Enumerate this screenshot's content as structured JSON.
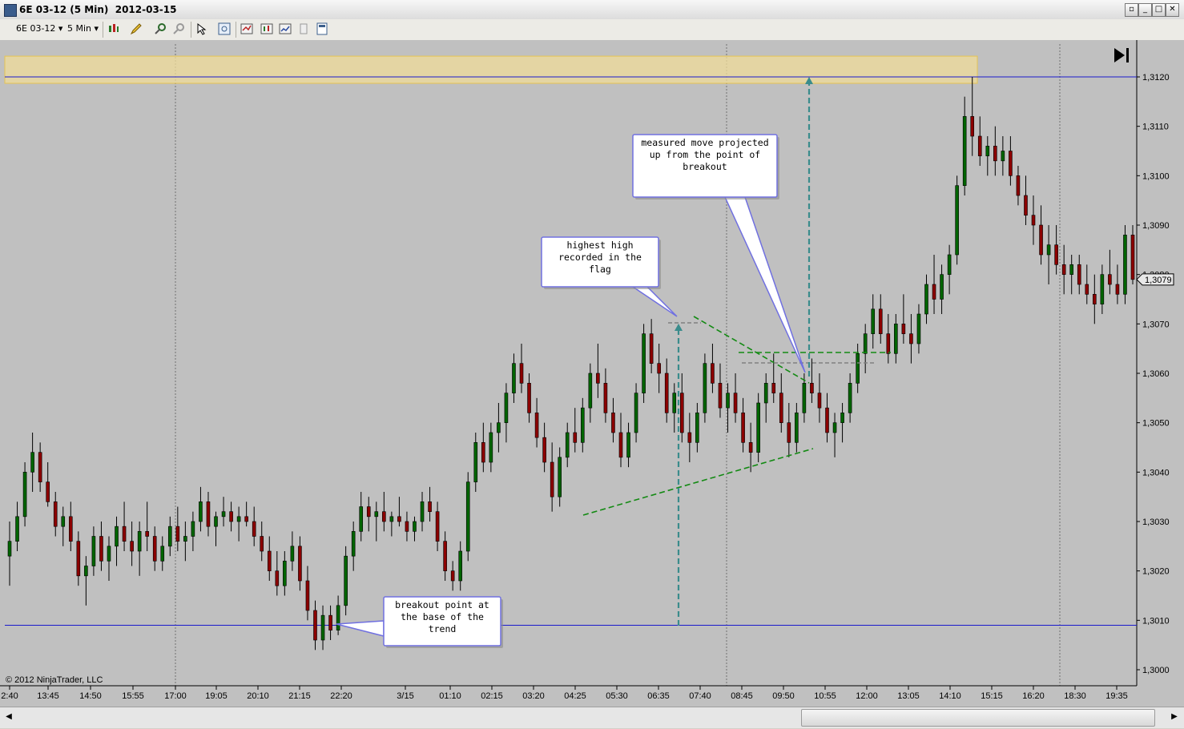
{
  "window": {
    "title": "6E 03-12 (5 Min)  2012-03-15",
    "buttons": [
      "restore-left",
      "minimize",
      "maximize",
      "close"
    ]
  },
  "toolbar": {
    "instrument": "6E 03-12",
    "interval": "5 Min",
    "icons": [
      "bar-type-icon",
      "draw-pencil-icon",
      "zoom-in-icon",
      "zoom-out-icon",
      "pointer-icon",
      "magnifier-icon",
      "indicators-icon",
      "strategies-icon",
      "chart-properties-icon",
      "data-box-icon",
      "panel-icon"
    ]
  },
  "chart_data": {
    "type": "candlestick",
    "instrument": "6E 03-12",
    "period": "5 Min",
    "copyright": "© 2012 NinjaTrader, LLC",
    "y_ticks": [
      "1,3120",
      "1,3110",
      "1,3100",
      "1,3090",
      "1,3080",
      "1,3070",
      "1,3060",
      "1,3050",
      "1,3040",
      "1,3030",
      "1,3020",
      "1,3010",
      "1,3000"
    ],
    "ylim": [
      1.2998,
      1.3126
    ],
    "current_price_label": "1,3079",
    "current_price": 1.3079,
    "x_ticks": [
      "2:40",
      "13:45",
      "14:50",
      "15:55",
      "17:00",
      "19:05",
      "20:10",
      "21:15",
      "22:20",
      "3/15",
      "01:10",
      "02:15",
      "03:20",
      "04:25",
      "05:30",
      "06:35",
      "07:40",
      "08:45",
      "09:50",
      "10:55",
      "12:00",
      "13:05",
      "14:10",
      "15:15",
      "16:20",
      "18:30",
      "19:35"
    ],
    "horizontal_lines": [
      {
        "name": "resistance-line",
        "price": 1.312,
        "color": "#1a1acc"
      },
      {
        "name": "breakout-base-line",
        "price": 1.3009,
        "color": "#1a1acc"
      }
    ],
    "resistance_zone": {
      "from": 1.31187,
      "to": 1.31242,
      "color": "#f0dc9a"
    },
    "candles": [
      [
        1.3023,
        1.303,
        1.3017,
        1.3026
      ],
      [
        1.3026,
        1.3034,
        1.3024,
        1.3031
      ],
      [
        1.3031,
        1.3042,
        1.3029,
        1.304
      ],
      [
        1.304,
        1.3048,
        1.3036,
        1.3044
      ],
      [
        1.3044,
        1.3046,
        1.3036,
        1.3038
      ],
      [
        1.3038,
        1.3042,
        1.3033,
        1.3034
      ],
      [
        1.3034,
        1.3036,
        1.3027,
        1.3029
      ],
      [
        1.3029,
        1.3033,
        1.3025,
        1.3031
      ],
      [
        1.3031,
        1.3034,
        1.3024,
        1.3026
      ],
      [
        1.3026,
        1.3028,
        1.3017,
        1.3019
      ],
      [
        1.3019,
        1.3023,
        1.3013,
        1.3021
      ],
      [
        1.3021,
        1.3029,
        1.3019,
        1.3027
      ],
      [
        1.3027,
        1.303,
        1.302,
        1.3022
      ],
      [
        1.3022,
        1.3027,
        1.3018,
        1.3025
      ],
      [
        1.3025,
        1.3031,
        1.3021,
        1.3029
      ],
      [
        1.3029,
        1.3034,
        1.3024,
        1.3026
      ],
      [
        1.3026,
        1.303,
        1.3021,
        1.3024
      ],
      [
        1.3024,
        1.303,
        1.3019,
        1.3028
      ],
      [
        1.3028,
        1.3034,
        1.3024,
        1.3027
      ],
      [
        1.3027,
        1.3029,
        1.302,
        1.3022
      ],
      [
        1.3022,
        1.3027,
        1.302,
        1.3025
      ],
      [
        1.3025,
        1.3031,
        1.3023,
        1.3029
      ],
      [
        1.3029,
        1.3033,
        1.3024,
        1.3026
      ],
      [
        1.3026,
        1.303,
        1.3022,
        1.3027
      ],
      [
        1.3027,
        1.3032,
        1.3024,
        1.303
      ],
      [
        1.303,
        1.3037,
        1.3028,
        1.3034
      ],
      [
        1.3034,
        1.3036,
        1.3027,
        1.3029
      ],
      [
        1.3029,
        1.3032,
        1.3025,
        1.3031
      ],
      [
        1.3031,
        1.3035,
        1.3029,
        1.3032
      ],
      [
        1.3032,
        1.3034,
        1.3028,
        1.303
      ],
      [
        1.303,
        1.3033,
        1.3026,
        1.3031
      ],
      [
        1.3031,
        1.3034,
        1.3029,
        1.303
      ],
      [
        1.303,
        1.3033,
        1.3025,
        1.3027
      ],
      [
        1.3027,
        1.303,
        1.3022,
        1.3024
      ],
      [
        1.3024,
        1.3027,
        1.3018,
        1.302
      ],
      [
        1.302,
        1.3024,
        1.3015,
        1.3017
      ],
      [
        1.3017,
        1.3024,
        1.3015,
        1.3022
      ],
      [
        1.3022,
        1.3028,
        1.302,
        1.3025
      ],
      [
        1.3025,
        1.3027,
        1.3016,
        1.3018
      ],
      [
        1.3018,
        1.3021,
        1.301,
        1.3012
      ],
      [
        1.3012,
        1.3014,
        1.3004,
        1.3006
      ],
      [
        1.3006,
        1.3013,
        1.3004,
        1.3011
      ],
      [
        1.3011,
        1.3013,
        1.3006,
        1.3008
      ],
      [
        1.3008,
        1.3015,
        1.3007,
        1.3013
      ],
      [
        1.3013,
        1.3025,
        1.3011,
        1.3023
      ],
      [
        1.3023,
        1.303,
        1.302,
        1.3028
      ],
      [
        1.3028,
        1.3036,
        1.3026,
        1.3033
      ],
      [
        1.3033,
        1.3035,
        1.3028,
        1.3031
      ],
      [
        1.3031,
        1.3034,
        1.3026,
        1.3032
      ],
      [
        1.3032,
        1.3036,
        1.3028,
        1.303
      ],
      [
        1.303,
        1.3032,
        1.3027,
        1.3031
      ],
      [
        1.3031,
        1.3035,
        1.3029,
        1.303
      ],
      [
        1.303,
        1.3032,
        1.3026,
        1.3028
      ],
      [
        1.3028,
        1.3031,
        1.3026,
        1.303
      ],
      [
        1.303,
        1.3036,
        1.3028,
        1.3034
      ],
      [
        1.3034,
        1.3037,
        1.303,
        1.3032
      ],
      [
        1.3032,
        1.3034,
        1.3024,
        1.3026
      ],
      [
        1.3026,
        1.3028,
        1.3018,
        1.302
      ],
      [
        1.302,
        1.3022,
        1.3016,
        1.3018
      ],
      [
        1.3018,
        1.3026,
        1.3016,
        1.3024
      ],
      [
        1.3024,
        1.304,
        1.3022,
        1.3038
      ],
      [
        1.3038,
        1.3048,
        1.3036,
        1.3046
      ],
      [
        1.3046,
        1.305,
        1.304,
        1.3042
      ],
      [
        1.3042,
        1.305,
        1.304,
        1.3048
      ],
      [
        1.3048,
        1.3054,
        1.3044,
        1.305
      ],
      [
        1.305,
        1.3058,
        1.3046,
        1.3056
      ],
      [
        1.3056,
        1.3064,
        1.3054,
        1.3062
      ],
      [
        1.3062,
        1.3066,
        1.3056,
        1.3058
      ],
      [
        1.3058,
        1.306,
        1.305,
        1.3052
      ],
      [
        1.3052,
        1.3055,
        1.3045,
        1.3047
      ],
      [
        1.3047,
        1.305,
        1.304,
        1.3042
      ],
      [
        1.3042,
        1.3046,
        1.3032,
        1.3035
      ],
      [
        1.3035,
        1.3045,
        1.3033,
        1.3043
      ],
      [
        1.3043,
        1.305,
        1.3041,
        1.3048
      ],
      [
        1.3048,
        1.3053,
        1.3044,
        1.3046
      ],
      [
        1.3046,
        1.3055,
        1.3044,
        1.3053
      ],
      [
        1.3053,
        1.3062,
        1.305,
        1.306
      ],
      [
        1.306,
        1.3066,
        1.3055,
        1.3058
      ],
      [
        1.3058,
        1.3061,
        1.305,
        1.3052
      ],
      [
        1.3052,
        1.3055,
        1.3046,
        1.3048
      ],
      [
        1.3048,
        1.3052,
        1.3041,
        1.3043
      ],
      [
        1.3043,
        1.305,
        1.3041,
        1.3048
      ],
      [
        1.3048,
        1.3058,
        1.3046,
        1.3056
      ],
      [
        1.3056,
        1.307,
        1.3054,
        1.3068
      ],
      [
        1.3068,
        1.3071,
        1.306,
        1.3062
      ],
      [
        1.3062,
        1.3066,
        1.3056,
        1.306
      ],
      [
        1.306,
        1.3063,
        1.305,
        1.3052
      ],
      [
        1.3052,
        1.3058,
        1.3048,
        1.3056
      ],
      [
        1.3056,
        1.306,
        1.3046,
        1.3048
      ],
      [
        1.3048,
        1.3052,
        1.3042,
        1.3046
      ],
      [
        1.3046,
        1.3054,
        1.3044,
        1.3052
      ],
      [
        1.3052,
        1.3064,
        1.305,
        1.3062
      ],
      [
        1.3062,
        1.3066,
        1.3056,
        1.3058
      ],
      [
        1.3058,
        1.3062,
        1.3051,
        1.3053
      ],
      [
        1.3053,
        1.3058,
        1.3048,
        1.3056
      ],
      [
        1.3056,
        1.306,
        1.305,
        1.3052
      ],
      [
        1.3052,
        1.3055,
        1.3044,
        1.3046
      ],
      [
        1.3046,
        1.305,
        1.304,
        1.3044
      ],
      [
        1.3044,
        1.3056,
        1.3042,
        1.3054
      ],
      [
        1.3054,
        1.306,
        1.305,
        1.3058
      ],
      [
        1.3058,
        1.3064,
        1.3054,
        1.3056
      ],
      [
        1.3056,
        1.306,
        1.3048,
        1.305
      ],
      [
        1.305,
        1.3054,
        1.3043,
        1.3046
      ],
      [
        1.3046,
        1.3054,
        1.3044,
        1.3052
      ],
      [
        1.3052,
        1.306,
        1.305,
        1.3058
      ],
      [
        1.3058,
        1.3063,
        1.3054,
        1.3056
      ],
      [
        1.3056,
        1.306,
        1.305,
        1.3053
      ],
      [
        1.3053,
        1.3056,
        1.3046,
        1.3048
      ],
      [
        1.3048,
        1.3052,
        1.3043,
        1.305
      ],
      [
        1.305,
        1.3054,
        1.3046,
        1.3052
      ],
      [
        1.3052,
        1.306,
        1.305,
        1.3058
      ],
      [
        1.3058,
        1.3066,
        1.3056,
        1.3064
      ],
      [
        1.3064,
        1.307,
        1.306,
        1.3068
      ],
      [
        1.3068,
        1.3076,
        1.3065,
        1.3073
      ],
      [
        1.3073,
        1.3076,
        1.3066,
        1.3068
      ],
      [
        1.3068,
        1.3072,
        1.3062,
        1.3064
      ],
      [
        1.3064,
        1.3072,
        1.3062,
        1.307
      ],
      [
        1.307,
        1.3076,
        1.3066,
        1.3068
      ],
      [
        1.3068,
        1.3072,
        1.3062,
        1.3066
      ],
      [
        1.3066,
        1.3074,
        1.3064,
        1.3072
      ],
      [
        1.3072,
        1.308,
        1.307,
        1.3078
      ],
      [
        1.3078,
        1.3084,
        1.3072,
        1.3075
      ],
      [
        1.3075,
        1.3082,
        1.3072,
        1.308
      ],
      [
        1.308,
        1.3086,
        1.3076,
        1.3084
      ],
      [
        1.3084,
        1.31,
        1.3082,
        1.3098
      ],
      [
        1.3098,
        1.3116,
        1.3096,
        1.3112
      ],
      [
        1.3112,
        1.312,
        1.3104,
        1.3108
      ],
      [
        1.3108,
        1.3112,
        1.3102,
        1.3104
      ],
      [
        1.3104,
        1.3108,
        1.31,
        1.3106
      ],
      [
        1.3106,
        1.311,
        1.31,
        1.3103
      ],
      [
        1.3103,
        1.3108,
        1.31,
        1.3105
      ],
      [
        1.3105,
        1.3108,
        1.3098,
        1.31
      ],
      [
        1.31,
        1.3102,
        1.3094,
        1.3096
      ],
      [
        1.3096,
        1.31,
        1.309,
        1.3092
      ],
      [
        1.3092,
        1.3096,
        1.3086,
        1.309
      ],
      [
        1.309,
        1.3094,
        1.3082,
        1.3084
      ],
      [
        1.3084,
        1.309,
        1.3078,
        1.3086
      ],
      [
        1.3086,
        1.309,
        1.308,
        1.3082
      ],
      [
        1.3082,
        1.3086,
        1.3076,
        1.308
      ],
      [
        1.308,
        1.3084,
        1.3076,
        1.3082
      ],
      [
        1.3082,
        1.3084,
        1.3076,
        1.3078
      ],
      [
        1.3078,
        1.3082,
        1.3074,
        1.3076
      ],
      [
        1.3076,
        1.308,
        1.307,
        1.3074
      ],
      [
        1.3074,
        1.3082,
        1.3072,
        1.308
      ],
      [
        1.308,
        1.3085,
        1.3076,
        1.3078
      ],
      [
        1.3078,
        1.3082,
        1.3074,
        1.3076
      ],
      [
        1.3076,
        1.309,
        1.3074,
        1.3088
      ],
      [
        1.3088,
        1.309,
        1.3078,
        1.3079
      ]
    ],
    "annotations": [
      {
        "text": "measured move projected up from the point of breakout"
      },
      {
        "text": "highest high recorded in the flag"
      },
      {
        "text": "breakout point at the base of the trend"
      }
    ],
    "colors": {
      "background": "#c0c0c0",
      "up": "#006400",
      "down": "#8b0000",
      "wick": "#000000",
      "trendline": "#138a13",
      "arrow": "#3a8c8c"
    }
  }
}
